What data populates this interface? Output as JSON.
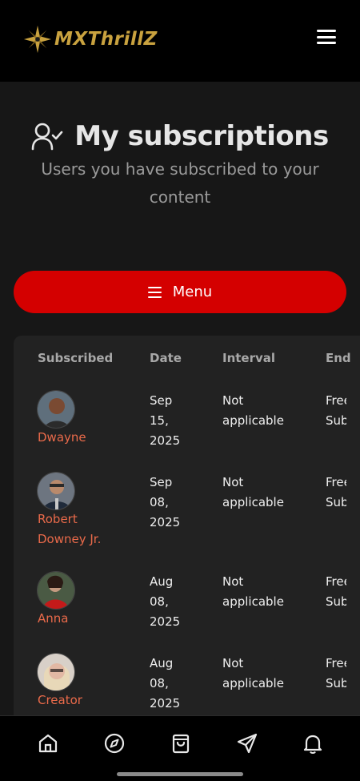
{
  "brand": {
    "name": "MXThrillZ",
    "accent": "#c9a23f"
  },
  "header": {
    "menu_icon": "hamburger-icon"
  },
  "page": {
    "title": "My subscriptions",
    "subtitle": "Users you have subscribed to your content",
    "title_icon": "user-check-icon"
  },
  "menu_button": {
    "label": "Menu",
    "color": "#d40000"
  },
  "table": {
    "columns": [
      "Subscribed",
      "Date",
      "Interval",
      "End"
    ],
    "rows": [
      {
        "name": "Dwayne",
        "date": "Sep\n15,\n2025",
        "interval": "Not\napplicable",
        "end": "Free\nSubscription"
      },
      {
        "name": "Robert Downey Jr.",
        "date": "Sep\n08,\n2025",
        "interval": "Not\napplicable",
        "end": "Free\nSubscription"
      },
      {
        "name": "Anna",
        "date": "Aug\n08,\n2025",
        "interval": "Not\napplicable",
        "end": "Free\nSubscription"
      },
      {
        "name": "Creator",
        "date": "Aug\n08,\n2025",
        "interval": "Not\napplicable",
        "end": "Free\nSubscription"
      }
    ]
  },
  "bottom_nav": {
    "items": [
      "home-icon",
      "compass-icon",
      "shopping-bag-icon",
      "send-icon",
      "bell-icon"
    ]
  }
}
